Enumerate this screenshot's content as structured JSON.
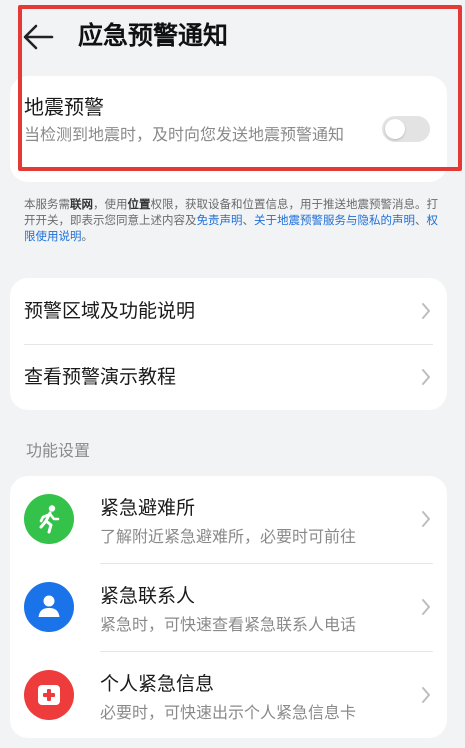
{
  "header": {
    "title": "应急预警通知"
  },
  "earthquake": {
    "title": "地震预警",
    "description": "当检测到地震时，及时向您发送地震预警通知",
    "enabled": false
  },
  "notice": {
    "p1": "本服务需",
    "network": "联网",
    "p2": "，使用",
    "location": "位置",
    "p3": "权限，获取设备和位置信息，用于推送地震预警消息。打开开关，即表示您同意上述内容及",
    "link_disclaimer": "免责声明",
    "p4": "、",
    "link_privacy": "关于地震预警服务与隐私的声明",
    "p5": "、",
    "link_permission": "权限使用说明",
    "p6": "。"
  },
  "menu": {
    "items": [
      {
        "label": "预警区域及功能说明"
      },
      {
        "label": "查看预警演示教程"
      }
    ]
  },
  "function_settings": {
    "section_label": "功能设置",
    "items": [
      {
        "title": "紧急避难所",
        "subtitle": "了解附近紧急避难所，必要时可前往",
        "icon": "running-person-icon",
        "color": "#35c24b"
      },
      {
        "title": "紧急联系人",
        "subtitle": "紧急时，可快速查看紧急联系人电话",
        "icon": "contact-person-icon",
        "color": "#1a73e8"
      },
      {
        "title": "个人紧急信息",
        "subtitle": "必要时，可快速出示个人紧急信息卡",
        "icon": "medical-card-icon",
        "color": "#ee3b3b"
      }
    ]
  }
}
